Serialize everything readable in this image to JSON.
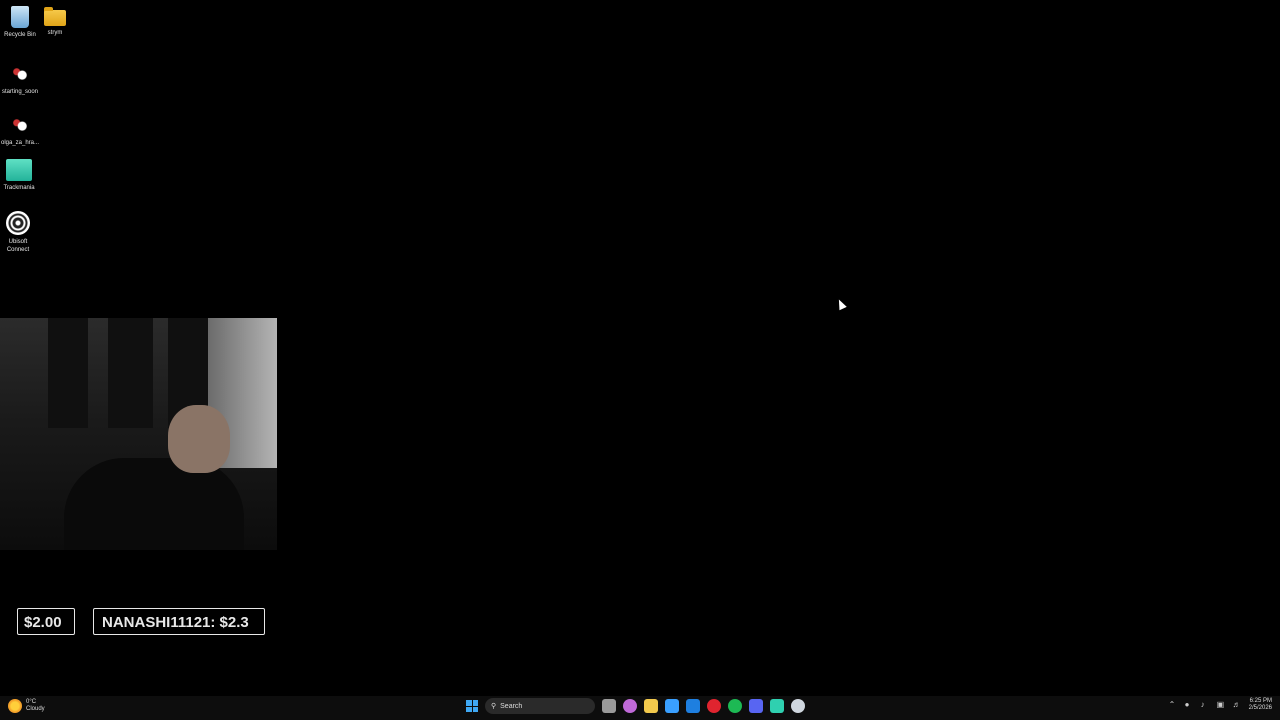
{
  "desktop": {
    "icons": [
      {
        "label": "Recycle Bin",
        "icon": "recycle-bin-icon"
      },
      {
        "label": "strym",
        "icon": "folder-icon"
      },
      {
        "label": "starting_soon",
        "icon": "obs-scene-icon"
      },
      {
        "label": "olga_za_hra...",
        "icon": "obs-scene-icon"
      },
      {
        "label": "Trackmania",
        "icon": "trackmania-icon"
      },
      {
        "label": "Ubisoft Connect",
        "icon": "ubisoft-connect-icon"
      }
    ]
  },
  "overlay": {
    "donation_amount": "$2.00",
    "donation_ticker": "NANASHI11121: $2.3"
  },
  "taskbar": {
    "weather": {
      "temp": "0°C",
      "condition": "Cloudy"
    },
    "search_placeholder": "Search",
    "apps": [
      {
        "icon": "task-view-icon",
        "color": "#9a9a9a"
      },
      {
        "icon": "copilot-icon",
        "color": "#c06ad8"
      },
      {
        "icon": "file-explorer-icon",
        "color": "#f2c94c"
      },
      {
        "icon": "store-icon",
        "color": "#3aa0ff"
      },
      {
        "icon": "outlook-icon",
        "color": "#1e7fe0"
      },
      {
        "icon": "opera-icon",
        "color": "#e0242f"
      },
      {
        "icon": "spotify-icon",
        "color": "#1db954"
      },
      {
        "icon": "discord-icon",
        "color": "#5865f2"
      },
      {
        "icon": "trackmania-taskbar-icon",
        "color": "#2fd0b0"
      },
      {
        "icon": "steam-icon",
        "color": "#cfd6de"
      }
    ],
    "clock": {
      "time": "6:25 PM",
      "date": "2/5/2026"
    }
  }
}
